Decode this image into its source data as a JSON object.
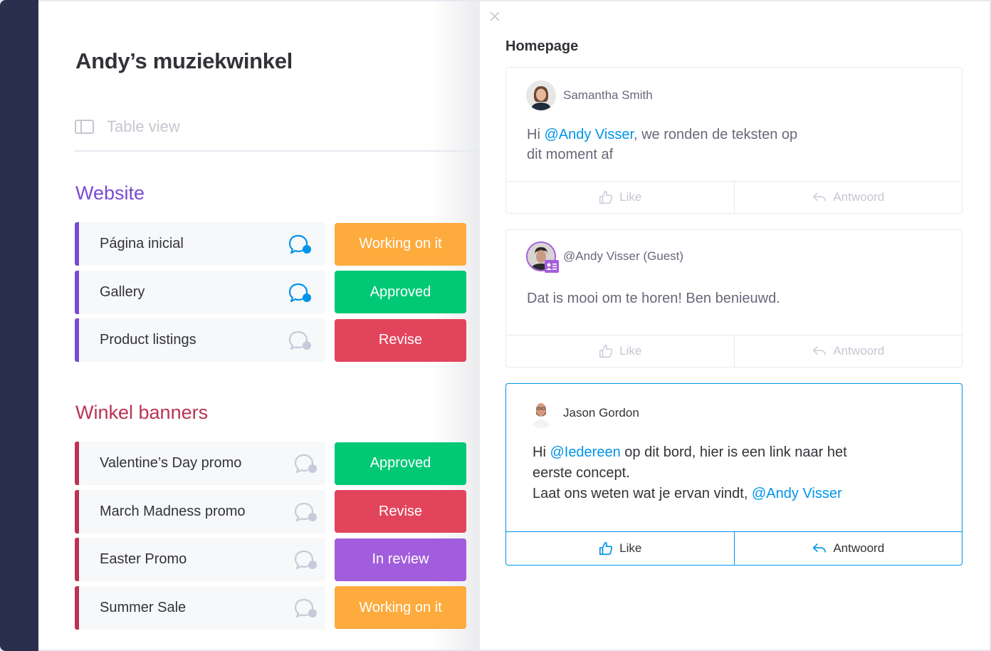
{
  "board": {
    "title": "Andy’s muziekwinkel",
    "view_label": "Table view",
    "groups": [
      {
        "title": "Website",
        "color": "#784bd1",
        "items": [
          {
            "label": "Página inicial",
            "status": "Working on it",
            "status_color": "#fdab3d",
            "has_updates": true
          },
          {
            "label": "Gallery",
            "status": "Approved",
            "status_color": "#00c875",
            "has_updates": true
          },
          {
            "label": "Product listings",
            "status": "Revise",
            "status_color": "#e2445c",
            "has_updates": false
          }
        ]
      },
      {
        "title": "Winkel banners",
        "color": "#bb3354",
        "items": [
          {
            "label": "Valentine’s Day promo",
            "status": "Approved",
            "status_color": "#00c875",
            "has_updates": false
          },
          {
            "label": "March Madness promo",
            "status": "Revise",
            "status_color": "#e2445c",
            "has_updates": false
          },
          {
            "label": "Easter Promo",
            "status": "In review",
            "status_color": "#a25ddc",
            "has_updates": false
          },
          {
            "label": "Summer Sale",
            "status": "Working on it",
            "status_color": "#fdab3d",
            "has_updates": false
          }
        ]
      }
    ]
  },
  "panel": {
    "title": "Homepage",
    "close_icon": "close-icon",
    "updates": [
      {
        "author": "Samantha Smith",
        "message_parts": [
          {
            "text": "Hi "
          },
          {
            "text": "@Andy Visser",
            "mention": true
          },
          {
            "text": ", we ronden de teksten op"
          },
          {
            "br": true
          },
          {
            "text": "dit moment af"
          }
        ],
        "like_label": "Like",
        "reply_label": "Antwoord",
        "active": false
      },
      {
        "author": "@Andy Visser (Guest)",
        "guest_badge": true,
        "message_parts": [
          {
            "text": "Dat is mooi om te horen! Ben benieuwd."
          }
        ],
        "like_label": "Like",
        "reply_label": "Antwoord",
        "active": false
      },
      {
        "author": "Jason Gordon",
        "message_parts": [
          {
            "text": "Hi "
          },
          {
            "text": "@Iedereen",
            "mention": true
          },
          {
            "text": " op dit bord, hier is een link naar het"
          },
          {
            "br": true
          },
          {
            "text": "eerste concept."
          },
          {
            "br": true
          },
          {
            "text": "Laat ons weten wat je ervan vindt, "
          },
          {
            "text": "@Andy Visser",
            "mention": true
          }
        ],
        "like_label": "Like",
        "reply_label": "Antwoord",
        "active": true
      }
    ]
  },
  "colors": {
    "sidebar": "#292f4c",
    "accent": "#0093e8",
    "inactive_icon": "#c5cbd9"
  }
}
